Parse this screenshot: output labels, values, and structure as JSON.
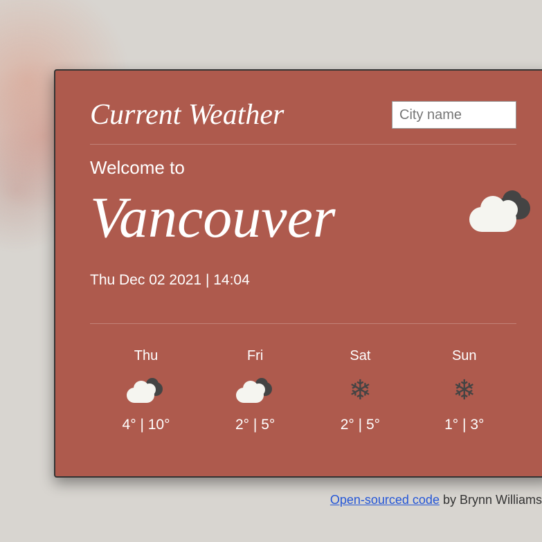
{
  "header": {
    "title": "Current Weather",
    "search_placeholder": "City name"
  },
  "main": {
    "welcome_label": "Welcome to",
    "city": "Vancouver",
    "datetime": "Thu Dec 02 2021 | 14:04",
    "icon": "cloudy"
  },
  "forecast": [
    {
      "day": "Thu",
      "icon": "cloudy",
      "low": "4°",
      "high": "10°"
    },
    {
      "day": "Fri",
      "icon": "cloudy",
      "low": "2°",
      "high": "5°"
    },
    {
      "day": "Sat",
      "icon": "snow",
      "low": "2°",
      "high": "5°"
    },
    {
      "day": "Sun",
      "icon": "snow",
      "low": "1°",
      "high": "3°"
    }
  ],
  "footer": {
    "link_text": "Open-sourced code",
    "byline": " by Brynn Williams"
  }
}
